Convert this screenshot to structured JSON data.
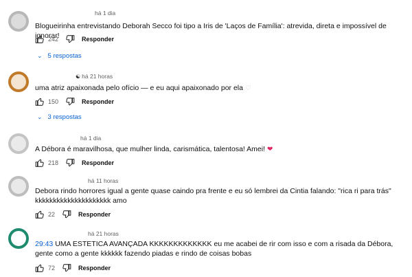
{
  "comments": [
    {
      "time": "há 1 dia",
      "text": "Blogueirinha entrevistando Deborah Secco foi tipo a Iris de 'Laços de Família': atrevida, direta e impossível de ignorar!",
      "likes": "242",
      "reply_label": "Responder",
      "replies_label": "5 respostas"
    },
    {
      "time": "há 21 horas",
      "text": "uma atriz apaixonada pelo ofício — e eu aqui apaixonado por ela",
      "heart": "♡",
      "likes": "150",
      "reply_label": "Responder",
      "replies_label": "3 respostas"
    },
    {
      "time": "há 1 dia",
      "text": "A Débora é maravilhosa, que mulher linda, carismática, talentosa! Amei!",
      "heart": "❤",
      "likes": "218",
      "reply_label": "Responder"
    },
    {
      "time": "há 11 horas",
      "line1": "Debora rindo horrores igual a gente quase caindo pra frente e eu só lembrei da Cintia falando: \"rica ri para trás\"",
      "line2": "kkkkkkkkkkkkkkkkkkkkk amo",
      "likes": "22",
      "reply_label": "Responder"
    },
    {
      "time": "há 21 horas",
      "timestamp": "29:43",
      "text": " UMA ESTETICA AVANÇADA KKKKKKKKKKKKK eu me acabei de rir com isso e com a risada da Débora, gente como a gente kkkkkk fazendo piadas e rindo de coisas bobas",
      "likes": "72",
      "reply_label": "Responder"
    }
  ],
  "colors": {
    "link": "#065fd4",
    "secondary_text": "#606060",
    "heart_red": "#e0245e"
  },
  "icons": {
    "like": "thumbs-up-icon",
    "dislike": "thumbs-down-icon",
    "expand": "chevron-down-icon",
    "member_badge": "yin-yang-icon"
  }
}
